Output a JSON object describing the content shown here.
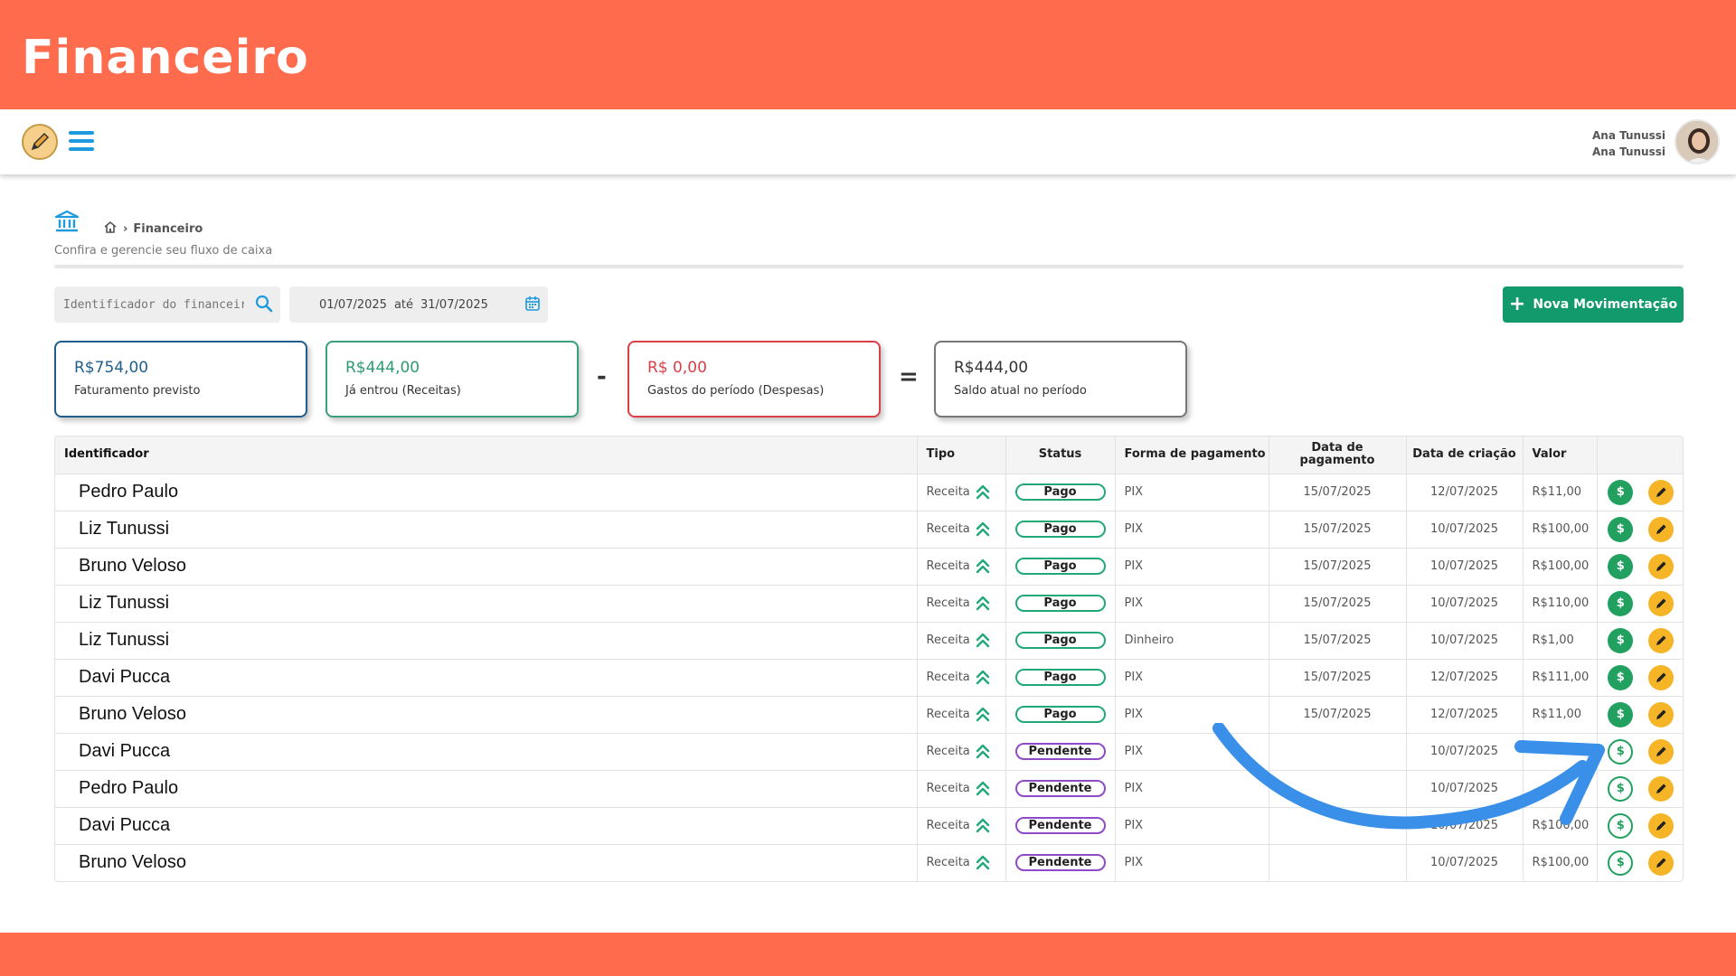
{
  "banner": {
    "title": "Financeiro"
  },
  "header": {
    "user_name": "Ana Tunussi",
    "user_subname": "Ana Tunussi"
  },
  "breadcrumb": {
    "current": "Financeiro"
  },
  "page": {
    "subtitle": "Confira e gerencie seu fluxo de caixa"
  },
  "filters": {
    "search_placeholder": "Identificador do financeiro",
    "date_start": "01/07/2025",
    "date_sep": "até",
    "date_end": "31/07/2025"
  },
  "actions": {
    "new_label": "Nova Movimentação"
  },
  "cards": {
    "faturamento": {
      "value": "R$754,00",
      "label": "Faturamento previsto"
    },
    "receitas": {
      "value": "R$444,00",
      "label": "Já entrou (Receitas)"
    },
    "despesas": {
      "value": "R$ 0,00",
      "label": "Gastos do período (Despesas)"
    },
    "saldo": {
      "value": "R$444,00",
      "label": "Saldo atual no período"
    },
    "op_minus": "-",
    "op_equals": "="
  },
  "table": {
    "headers": {
      "identificador": "Identificador",
      "tipo": "Tipo",
      "status": "Status",
      "forma": "Forma de pagamento",
      "data_pag_1": "Data de",
      "data_pag_2": "pagamento",
      "data_criacao": "Data de criação",
      "valor": "Valor"
    },
    "rows": [
      {
        "name": "Pedro Paulo",
        "tipo": "Receita",
        "status": "Pago",
        "forma": "PIX",
        "data_pag": "15/07/2025",
        "data_criacao": "12/07/2025",
        "valor": "R$11,00"
      },
      {
        "name": "Liz Tunussi",
        "tipo": "Receita",
        "status": "Pago",
        "forma": "PIX",
        "data_pag": "15/07/2025",
        "data_criacao": "10/07/2025",
        "valor": "R$100,00"
      },
      {
        "name": "Bruno Veloso",
        "tipo": "Receita",
        "status": "Pago",
        "forma": "PIX",
        "data_pag": "15/07/2025",
        "data_criacao": "10/07/2025",
        "valor": "R$100,00"
      },
      {
        "name": "Liz Tunussi",
        "tipo": "Receita",
        "status": "Pago",
        "forma": "PIX",
        "data_pag": "15/07/2025",
        "data_criacao": "10/07/2025",
        "valor": "R$110,00"
      },
      {
        "name": "Liz Tunussi",
        "tipo": "Receita",
        "status": "Pago",
        "forma": "Dinheiro",
        "data_pag": "15/07/2025",
        "data_criacao": "10/07/2025",
        "valor": "R$1,00"
      },
      {
        "name": "Davi Pucca",
        "tipo": "Receita",
        "status": "Pago",
        "forma": "PIX",
        "data_pag": "15/07/2025",
        "data_criacao": "12/07/2025",
        "valor": "R$111,00"
      },
      {
        "name": "Bruno Veloso",
        "tipo": "Receita",
        "status": "Pago",
        "forma": "PIX",
        "data_pag": "15/07/2025",
        "data_criacao": "12/07/2025",
        "valor": "R$11,00"
      },
      {
        "name": "Davi Pucca",
        "tipo": "Receita",
        "status": "Pendente",
        "forma": "PIX",
        "data_pag": "",
        "data_criacao": "10/07/2025",
        "valor": ""
      },
      {
        "name": "Pedro Paulo",
        "tipo": "Receita",
        "status": "Pendente",
        "forma": "PIX",
        "data_pag": "",
        "data_criacao": "10/07/2025",
        "valor": ""
      },
      {
        "name": "Davi Pucca",
        "tipo": "Receita",
        "status": "Pendente",
        "forma": "PIX",
        "data_pag": "",
        "data_criacao": "10/07/2025",
        "valor": "R$100,00"
      },
      {
        "name": "Bruno Veloso",
        "tipo": "Receita",
        "status": "Pendente",
        "forma": "PIX",
        "data_pag": "",
        "data_criacao": "10/07/2025",
        "valor": "R$100,00"
      }
    ]
  },
  "colors": {
    "banner": "#ff6b4d",
    "accent_green": "#129a6d",
    "card_faturamento": "#1f5f8b",
    "card_receitas": "#3aa07a",
    "card_despesas": "#d94048",
    "card_saldo": "#777777",
    "status_pago": "#22a877",
    "status_pendente": "#8e4bc7",
    "edit_button": "#f5b527",
    "arrow": "#3a90e8"
  },
  "icons": {
    "logo": "pencil-logo-icon",
    "menu": "hamburger-menu-icon",
    "page": "bank-icon",
    "home": "home-icon",
    "search": "search-icon",
    "calendar": "calendar-icon",
    "tipo": "double-chevron-up-icon",
    "pay": "dollar-icon",
    "edit": "pencil-icon"
  }
}
